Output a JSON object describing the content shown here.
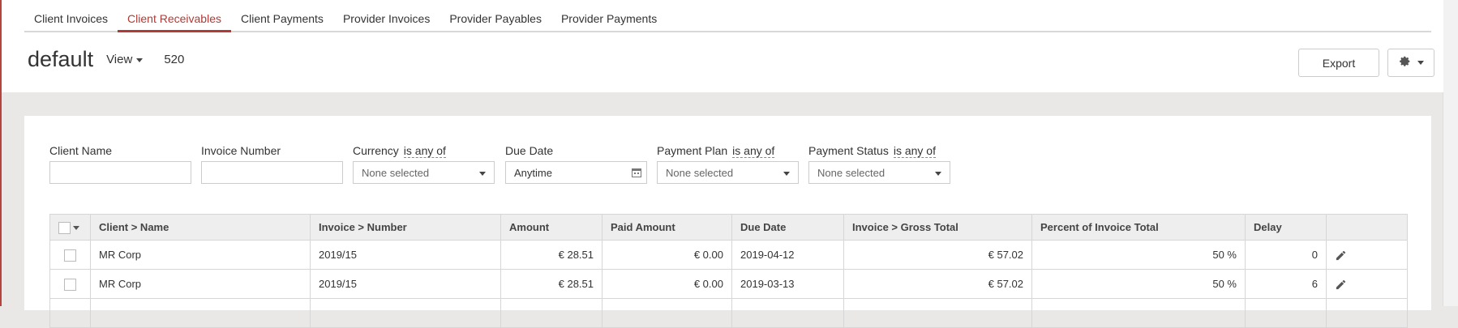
{
  "tabs": [
    {
      "label": "Client Invoices",
      "active": false
    },
    {
      "label": "Client Receivables",
      "active": true
    },
    {
      "label": "Client Payments",
      "active": false
    },
    {
      "label": "Provider Invoices",
      "active": false
    },
    {
      "label": "Provider Payables",
      "active": false
    },
    {
      "label": "Provider Payments",
      "active": false
    }
  ],
  "header": {
    "title": "default",
    "view_label": "View",
    "count": "520",
    "export_label": "Export",
    "settings_icon": "gear-icon"
  },
  "filters": {
    "client_name": {
      "label": "Client Name",
      "value": ""
    },
    "invoice_number": {
      "label": "Invoice Number",
      "value": ""
    },
    "currency": {
      "label": "Currency",
      "operator": "is any of",
      "value": "None selected"
    },
    "due_date": {
      "label": "Due Date",
      "value": "Anytime"
    },
    "payment_plan": {
      "label": "Payment Plan",
      "operator": "is any of",
      "value": "None selected"
    },
    "payment_status": {
      "label": "Payment Status",
      "operator": "is any of",
      "value": "None selected"
    }
  },
  "table": {
    "columns": [
      "Client > Name",
      "Invoice > Number",
      "Amount",
      "Paid Amount",
      "Due Date",
      "Invoice > Gross Total",
      "Percent of Invoice Total",
      "Delay"
    ],
    "rows": [
      [
        "MR Corp",
        "2019/15",
        "€ 28.51",
        "€ 0.00",
        "2019-04-12",
        "€ 57.02",
        "50 %",
        "0"
      ],
      [
        "MR Corp",
        "2019/15",
        "€ 28.51",
        "€ 0.00",
        "2019-03-13",
        "€ 57.02",
        "50 %",
        "6"
      ]
    ]
  },
  "colors": {
    "accent": "#b03a36",
    "header_bg": "#eeeeee",
    "page_bg": "#e9e8e6"
  }
}
